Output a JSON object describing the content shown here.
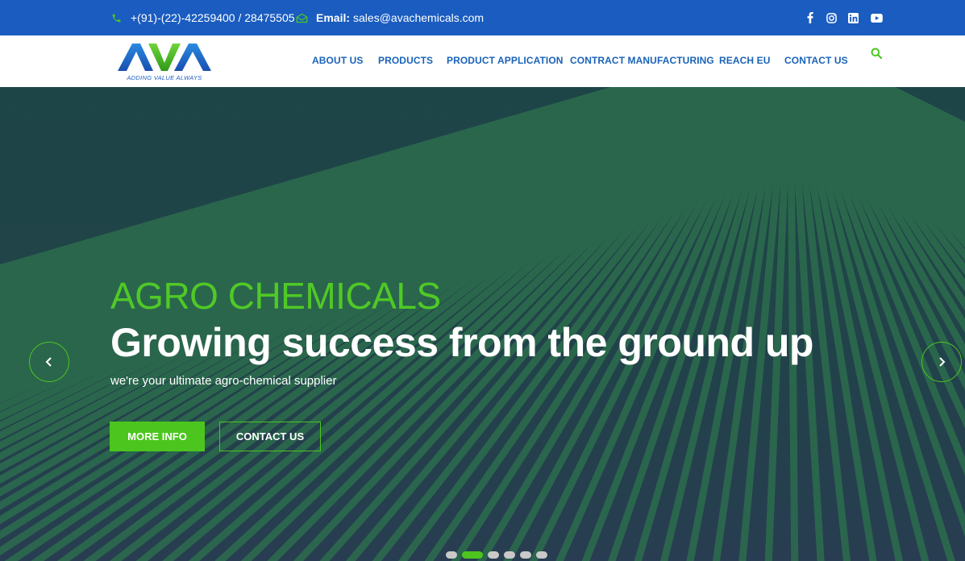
{
  "topbar": {
    "phone": "+(91)-(22)-42259400 / 28475505",
    "email_label": "Email:",
    "email": "sales@avachemicals.com",
    "icons": [
      "phone-icon",
      "envelope-icon",
      "facebook-icon",
      "instagram-icon",
      "linkedin-icon",
      "youtube-icon"
    ]
  },
  "header": {
    "logo_text": "AVA",
    "logo_tagline": "ADDING VALUE ALWAYS",
    "nav": [
      {
        "label": "ABOUT US"
      },
      {
        "label": "PRODUCTS"
      },
      {
        "label": "PRODUCT APPLICATION"
      },
      {
        "label": "CONTRACT MANUFACTURING"
      },
      {
        "label": "REACH EU"
      },
      {
        "label": "CONTACT US"
      }
    ],
    "search_icon": "search-icon"
  },
  "hero": {
    "eyebrow": "AGRO CHEMICALS",
    "headline": "Growing success from the ground up",
    "subtext": "we're your ultimate agro-chemical supplier",
    "primary_button": "MORE INFO",
    "secondary_button": "CONTACT US",
    "slides_total": 6,
    "active_slide": 2
  },
  "colors": {
    "topbar_bg": "#1a5cc0",
    "nav_text": "#1a63b8",
    "accent_green": "#4cc61e",
    "hero_text": "#ffffff"
  }
}
